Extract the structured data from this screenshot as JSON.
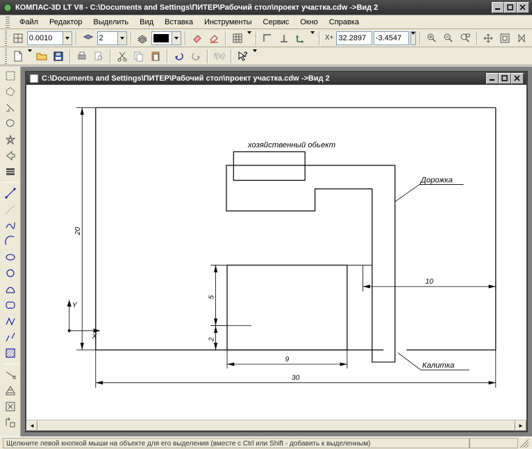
{
  "app": {
    "title": "КОМПАС-3D LT V8 - C:\\Documents and Settings\\ПИТЕР\\Рабочий стол\\проект участка.cdw ->Вид 2"
  },
  "menu": {
    "file": "Файл",
    "edit": "Редактор",
    "select": "Выделить",
    "view": "Вид",
    "insert": "Вставка",
    "tools": "Инструменты",
    "service": "Сервис",
    "window": "Окно",
    "help": "Справка"
  },
  "toolbar1": {
    "step": "0.0010",
    "layer": "2",
    "color_combo": "",
    "x_label": "X+",
    "x_val": "32.2897",
    "y_label": "",
    "y_val": "-3.4547"
  },
  "document": {
    "title": "C:\\Documents and Settings\\ПИТЕР\\Рабочий стол\\проект участка.cdw ->Вид 2"
  },
  "drawing": {
    "label_economic": "хозяйственный обьект",
    "label_path": "Дорожка",
    "label_gate": "Калитка",
    "dim_height": "20",
    "dim_width": "30",
    "dim_9": "9",
    "dim_5": "5",
    "dim_2": "2",
    "dim_10": "10",
    "axis_x": "X",
    "axis_y": "Y"
  },
  "status": {
    "text": "Щелкните левой кнопкой мыши на объекте для его выделения (вместе с Ctrl или Shift - добавить к выделенным)"
  }
}
